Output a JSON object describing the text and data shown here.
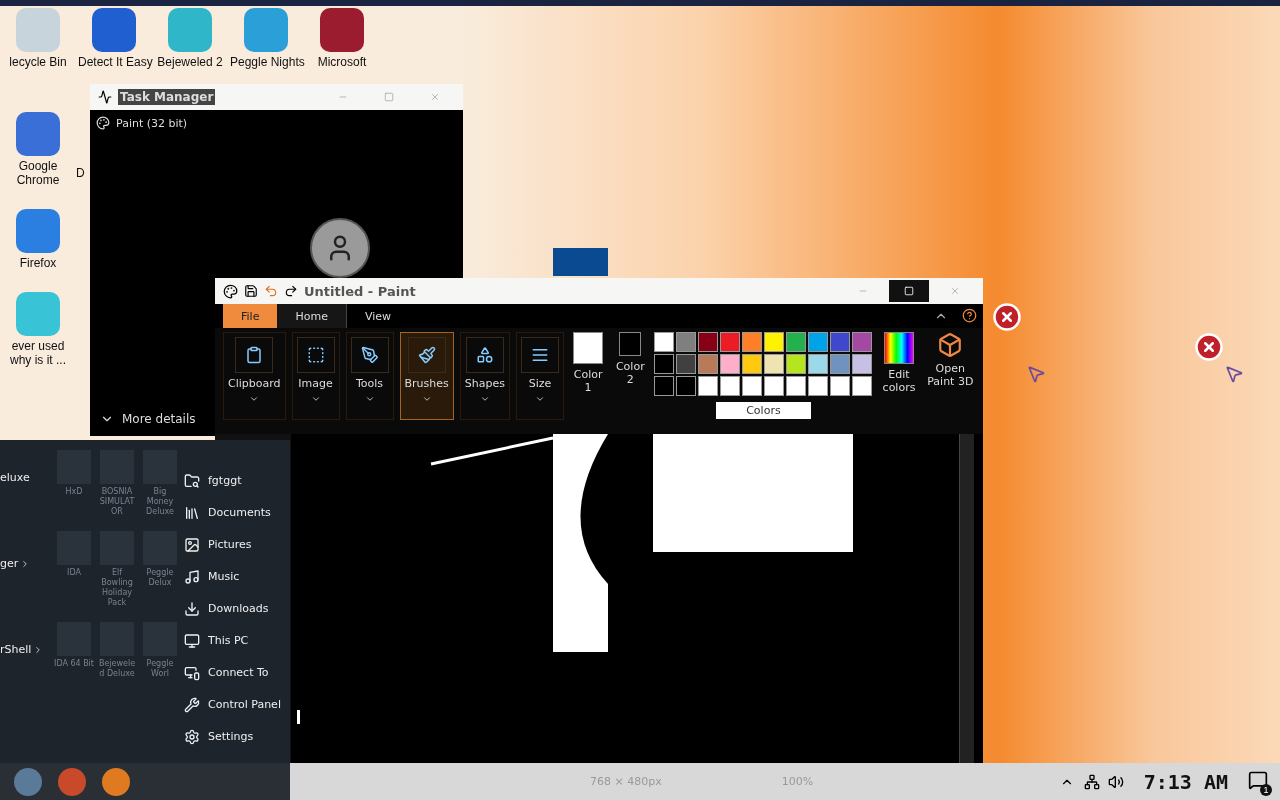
{
  "desktop_icons": [
    {
      "label": "lecycle Bin",
      "color": "#c8d4dc"
    },
    {
      "label": "Detect It Easy",
      "color": "#1f5fd0"
    },
    {
      "label": "Bejeweled 2",
      "color": "#2fb7c9"
    },
    {
      "label": "Peggle Nights",
      "color": "#2a9fd8"
    },
    {
      "label": "Microsoft",
      "color": "#9b1b2f"
    }
  ],
  "side_icons": [
    {
      "label": "Google Chrome",
      "color": "#3a6fd8"
    },
    {
      "label": "Firefox",
      "color": "#2b7fe0"
    },
    {
      "label": "ever used why is it ...",
      "color": "#39c3d6"
    }
  ],
  "hidden_icon_label": "D",
  "task_manager": {
    "title": "Task Manager",
    "apps": [
      {
        "name": "Paint (32 bit)"
      }
    ],
    "more_details": "More details"
  },
  "paint": {
    "title": "Untitled - Paint",
    "tabs": [
      {
        "label": "File",
        "kind": "file",
        "selected": false
      },
      {
        "label": "Home",
        "kind": "tab",
        "selected": true
      },
      {
        "label": "View",
        "kind": "tab",
        "selected": false
      }
    ],
    "tools": [
      {
        "label": "Clipboard",
        "kind": "clipboard",
        "selected": false
      },
      {
        "label": "Image",
        "kind": "image",
        "selected": false
      },
      {
        "label": "Tools",
        "kind": "tools",
        "selected": false
      },
      {
        "label": "Brushes",
        "kind": "brushes",
        "selected": true
      },
      {
        "label": "Shapes",
        "kind": "shapes",
        "selected": false
      },
      {
        "label": "Size",
        "kind": "size",
        "selected": false
      }
    ],
    "color1": "Color 1",
    "color2": "Color 2",
    "palette": [
      {
        "color": "#ffffff"
      },
      {
        "color": "#7f7f7f"
      },
      {
        "color": "#880015"
      },
      {
        "color": "#ed1c24"
      },
      {
        "color": "#ff7f27"
      },
      {
        "color": "#fff200"
      },
      {
        "color": "#22b14c"
      },
      {
        "color": "#00a2e8"
      },
      {
        "color": "#3f48cc"
      },
      {
        "color": "#a349a4"
      },
      {
        "color": "#000000"
      },
      {
        "color": "#404040"
      },
      {
        "color": "#b97a57"
      },
      {
        "color": "#ffaec9"
      },
      {
        "color": "#ffc90e"
      },
      {
        "color": "#efe4b0"
      },
      {
        "color": "#b5e61d"
      },
      {
        "color": "#99d9ea"
      },
      {
        "color": "#7092be"
      },
      {
        "color": "#c8bfe7"
      },
      {
        "color": "#000000"
      },
      {
        "color": "#000000"
      },
      {
        "color": "#ffffff"
      },
      {
        "color": "#ffffff"
      },
      {
        "color": "#ffffff"
      },
      {
        "color": "#ffffff"
      },
      {
        "color": "#ffffff"
      },
      {
        "color": "#ffffff"
      },
      {
        "color": "#ffffff"
      },
      {
        "color": "#ffffff"
      }
    ],
    "colors_label": "Colors",
    "edit_colors": "Edit colors",
    "paint3d": "Open Paint 3D",
    "status": {
      "size": "768 × 480px",
      "zoom": "100%"
    }
  },
  "start_menu": {
    "left": [
      {
        "label": "eluxe",
        "arrow": false
      },
      {
        "label": "ger",
        "arrow": true
      },
      {
        "label": "rShell",
        "arrow": true
      }
    ],
    "tiles": [
      {
        "label": "HxD"
      },
      {
        "label": "BOSNIA SIMULATOR"
      },
      {
        "label": "Big Money Deluxe"
      },
      {
        "label": "IDA"
      },
      {
        "label": "Elf Bowling Holiday Pack"
      },
      {
        "label": "Peggle Delux"
      },
      {
        "label": "IDA 64 Bit"
      },
      {
        "label": "Bejeweled Deluxe"
      },
      {
        "label": "Peggle Worl"
      }
    ],
    "places": [
      {
        "label": "fgtggt",
        "kind": "user"
      },
      {
        "label": "Documents",
        "kind": "documents"
      },
      {
        "label": "Pictures",
        "kind": "pictures"
      },
      {
        "label": "Music",
        "kind": "music"
      },
      {
        "label": "Downloads",
        "kind": "downloads"
      },
      {
        "label": "This PC",
        "kind": "pc"
      },
      {
        "label": "Connect To",
        "kind": "connect"
      },
      {
        "label": "Control Panel",
        "kind": "control"
      },
      {
        "label": "Settings",
        "kind": "settings"
      }
    ]
  },
  "tray": {
    "time": "7:13 AM",
    "notifications": "1"
  }
}
